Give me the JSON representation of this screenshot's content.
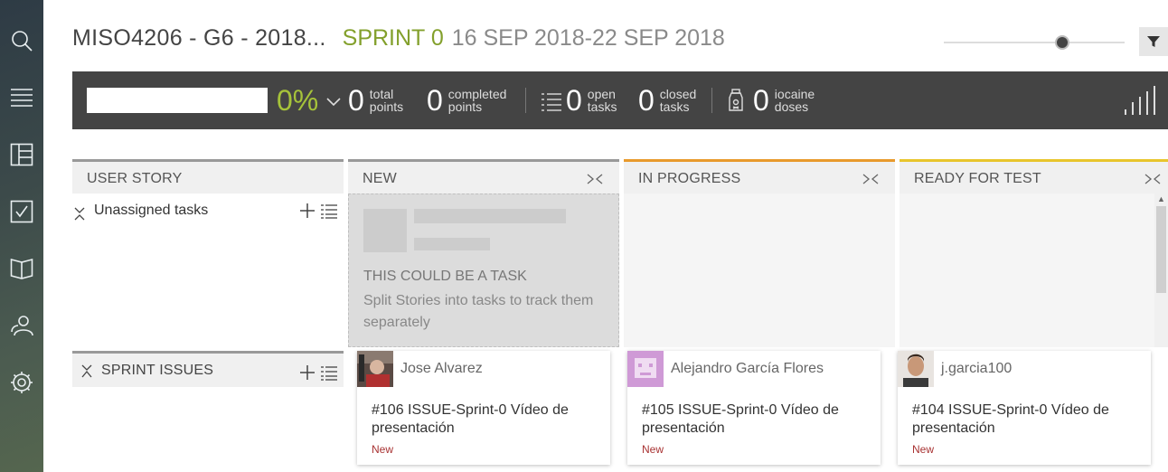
{
  "sidebar": {
    "items": [
      {
        "icon": "search-icon"
      },
      {
        "icon": "backlog-icon"
      },
      {
        "icon": "kanban-icon"
      },
      {
        "icon": "issues-icon"
      },
      {
        "icon": "wiki-icon"
      },
      {
        "icon": "team-icon"
      },
      {
        "icon": "settings-icon"
      }
    ]
  },
  "header": {
    "project": "MISO4206 - G6 - 2018...",
    "sprint_name": "SPRINT 0",
    "sprint_dates": "16 SEP 2018-22 SEP 2018",
    "zoom_level": 0.65
  },
  "stats": {
    "percent": "0%",
    "total_points": {
      "num": "0",
      "l1": "total",
      "l2": "points"
    },
    "completed_points": {
      "num": "0",
      "l1": "completed",
      "l2": "points"
    },
    "open_tasks": {
      "num": "0",
      "l1": "open",
      "l2": "tasks"
    },
    "closed_tasks": {
      "num": "0",
      "l1": "closed",
      "l2": "tasks"
    },
    "iocaine": {
      "num": "0",
      "l1": "iocaine",
      "l2": "doses"
    }
  },
  "columns": {
    "user_story": "USER STORY",
    "new": "NEW",
    "in_progress": "IN PROGRESS",
    "ready_for_test": "READY FOR TEST"
  },
  "colors": {
    "new": "#999999",
    "in_progress": "#e89a2c",
    "ready_for_test": "#e8c52c",
    "accent": "#83a02c"
  },
  "unassigned": {
    "label": "Unassigned tasks"
  },
  "placeholder": {
    "title": "THIS COULD BE A TASK",
    "desc": "Split Stories into tasks to track them separately"
  },
  "sprint_issues": {
    "label": "SPRINT ISSUES"
  },
  "cards": [
    {
      "assignee": "Jose Alvarez",
      "title": "#106 ISSUE-Sprint-0 Vídeo de presentación",
      "status": "New"
    },
    {
      "assignee": "Alejandro García Flores",
      "title": "#105 ISSUE-Sprint-0 Vídeo de presentación",
      "status": "New"
    },
    {
      "assignee": "j.garcia100",
      "title": "#104 ISSUE-Sprint-0 Vídeo de presentación",
      "status": "New"
    }
  ]
}
